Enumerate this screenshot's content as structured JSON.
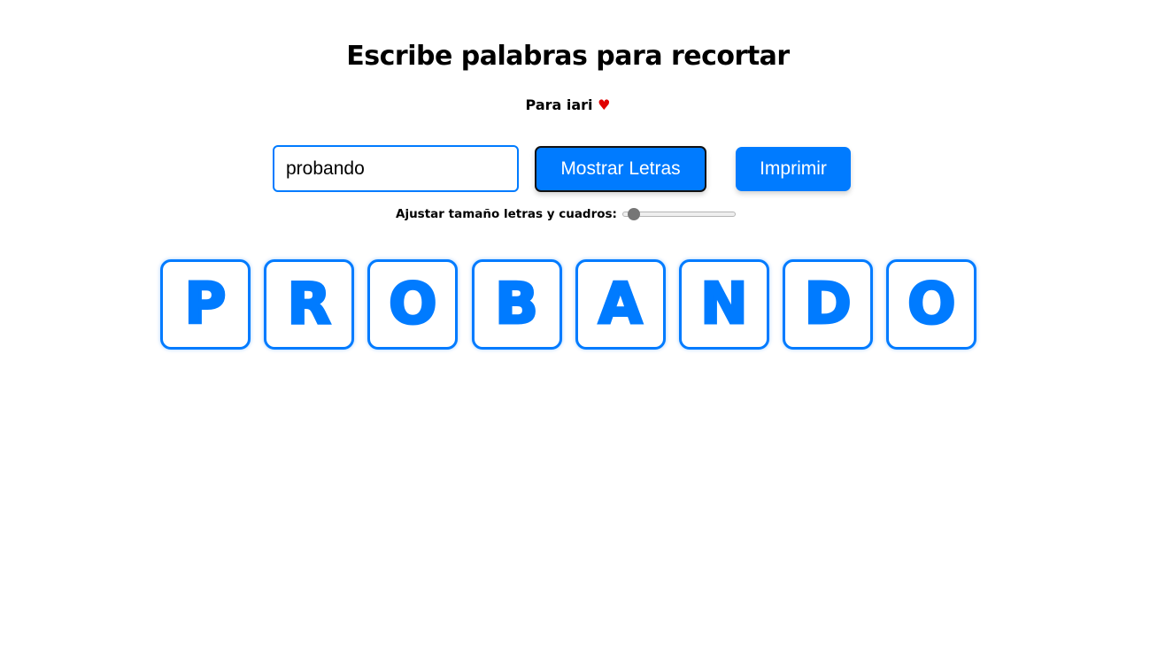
{
  "header": {
    "title": "Escribe palabras para recortar",
    "subtitle": "Para iari",
    "heart": "♥"
  },
  "controls": {
    "input_value": "probando",
    "show_button_label": "Mostrar Letras",
    "print_button_label": "Imprimir"
  },
  "size_slider": {
    "label": "Ajustar tamaño letras y cuadros:",
    "value_fraction": 0.05
  },
  "letters": [
    "P",
    "R",
    "O",
    "B",
    "A",
    "N",
    "D",
    "O"
  ],
  "colors": {
    "accent": "#007bff",
    "heart": "#e00000",
    "text": "#000000"
  }
}
